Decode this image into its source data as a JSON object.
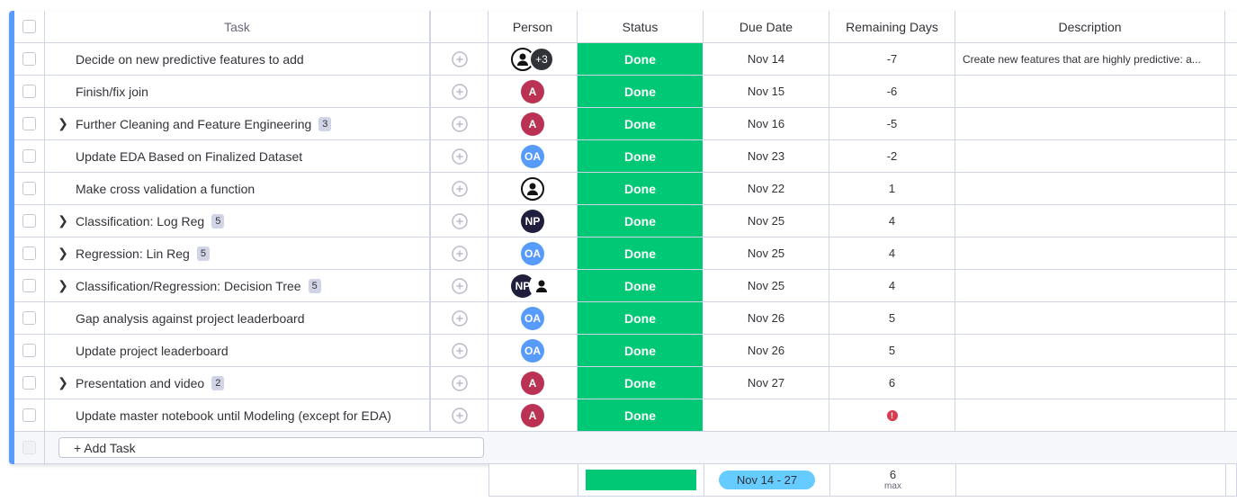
{
  "board": {
    "header": {
      "task": "Task",
      "person": "Person",
      "status": "Status",
      "due_date": "Due Date",
      "remaining_days": "Remaining Days",
      "description": "Description"
    },
    "rows": [
      {
        "task": "Decide on new predictive features to add",
        "subitems": "",
        "status": "Done",
        "due": "Nov 14",
        "remaining": "-7",
        "description": "Create new features that are highly predictive: a...",
        "avatar": "blank+3",
        "plus": "+3"
      },
      {
        "task": "Finish/fix join",
        "subitems": "",
        "status": "Done",
        "due": "Nov 15",
        "remaining": "-6",
        "description": "",
        "avatar": "A"
      },
      {
        "task": "Further Cleaning and Feature Engineering",
        "subitems": "3",
        "status": "Done",
        "due": "Nov 16",
        "remaining": "-5",
        "description": "",
        "avatar": "A"
      },
      {
        "task": "Update EDA Based on Finalized Dataset",
        "subitems": "",
        "status": "Done",
        "due": "Nov 23",
        "remaining": "-2",
        "description": "",
        "avatar": "OA"
      },
      {
        "task": "Make cross validation a function",
        "subitems": "",
        "status": "Done",
        "due": "Nov 22",
        "remaining": "1",
        "description": "",
        "avatar": "blank"
      },
      {
        "task": "Classification: Log Reg",
        "subitems": "5",
        "status": "Done",
        "due": "Nov 25",
        "remaining": "4",
        "description": "",
        "avatar": "NP"
      },
      {
        "task": "Regression: Lin Reg",
        "subitems": "5",
        "status": "Done",
        "due": "Nov 25",
        "remaining": "4",
        "description": "",
        "avatar": "OA"
      },
      {
        "task": "Classification/Regression: Decision Tree",
        "subitems": "5",
        "status": "Done",
        "due": "Nov 25",
        "remaining": "4",
        "description": "",
        "avatar": "NP+blank"
      },
      {
        "task": "Gap analysis against project leaderboard",
        "subitems": "",
        "status": "Done",
        "due": "Nov 26",
        "remaining": "5",
        "description": "",
        "avatar": "OA"
      },
      {
        "task": "Update project leaderboard",
        "subitems": "",
        "status": "Done",
        "due": "Nov 26",
        "remaining": "5",
        "description": "",
        "avatar": "OA"
      },
      {
        "task": "Presentation and video",
        "subitems": "2",
        "status": "Done",
        "due": "Nov 27",
        "remaining": "6",
        "description": "",
        "avatar": "A"
      },
      {
        "task": "Update master notebook until Modeling (except for EDA)",
        "subitems": "",
        "status": "Done",
        "due": "",
        "remaining": "!",
        "description": "",
        "avatar": "A"
      }
    ],
    "add_task_label": "+ Add Task",
    "footer": {
      "date_range": "Nov 14 - 27",
      "remaining_value": "6",
      "remaining_label": "max"
    },
    "colors": {
      "group": "#579bfc",
      "done": "#00c875",
      "avatar_a": "#bb3354",
      "avatar_oa": "#579bfc",
      "avatar_np": "#1f1f3d"
    }
  }
}
